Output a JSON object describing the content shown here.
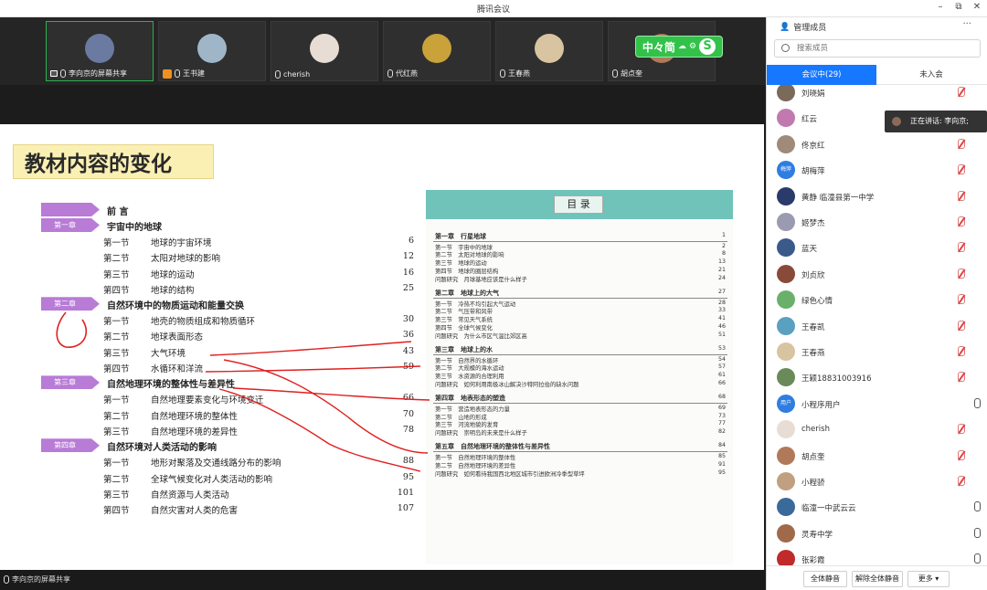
{
  "app": {
    "title": "腾讯会议"
  },
  "participants_strip": [
    {
      "name": "李向京的屏幕共享",
      "color": "#6a7aa0",
      "active": true
    },
    {
      "name": "王书建",
      "color": "#9fb6c8"
    },
    {
      "name": "cherish",
      "color": "#e8ddd4"
    },
    {
      "name": "代红燕",
      "color": "#c9a23a"
    },
    {
      "name": "王春燕",
      "color": "#d8c4a0"
    },
    {
      "name": "胡点奎",
      "color": "#b07a5a"
    }
  ],
  "ime": {
    "label": "中々简",
    "logo": "S"
  },
  "slide": {
    "title": "教材内容的变化",
    "toc": [
      {
        "tag": "",
        "title": "前 言",
        "sections": []
      },
      {
        "tag": "第一章",
        "title": "宇宙中的地球",
        "sections": [
          {
            "n": "第一节",
            "t": "地球的宇宙环境",
            "p": "6"
          },
          {
            "n": "第二节",
            "t": "太阳对地球的影响",
            "p": "12"
          },
          {
            "n": "第三节",
            "t": "地球的运动",
            "p": "16"
          },
          {
            "n": "第四节",
            "t": "地球的结构",
            "p": "25"
          }
        ]
      },
      {
        "tag": "第二章",
        "title": "自然环境中的物质运动和能量交换",
        "sections": [
          {
            "n": "第一节",
            "t": "地壳的物质组成和物质循环",
            "p": "30"
          },
          {
            "n": "第二节",
            "t": "地球表面形态",
            "p": "36"
          },
          {
            "n": "第三节",
            "t": "大气环境",
            "p": "43"
          },
          {
            "n": "第四节",
            "t": "水循环和洋流",
            "p": "59"
          }
        ]
      },
      {
        "tag": "第三章",
        "title": "自然地理环境的整体性与差异性",
        "sections": [
          {
            "n": "第一节",
            "t": "自然地理要素变化与环境变迁",
            "p": "66"
          },
          {
            "n": "第二节",
            "t": "自然地理环境的整体性",
            "p": "70"
          },
          {
            "n": "第三节",
            "t": "自然地理环境的差异性",
            "p": "78"
          }
        ]
      },
      {
        "tag": "第四章",
        "title": "自然环境对人类活动的影响",
        "sections": [
          {
            "n": "第一节",
            "t": "地形对聚落及交通线路分布的影响",
            "p": "88"
          },
          {
            "n": "第二节",
            "t": "全球气候变化对人类活动的影响",
            "p": "95"
          },
          {
            "n": "第三节",
            "t": "自然资源与人类活动",
            "p": "101"
          },
          {
            "n": "第四节",
            "t": "自然灾害对人类的危害",
            "p": "107"
          }
        ]
      }
    ],
    "book": {
      "heading": "目 录",
      "entries": [
        {
          "t": "第一章　行星地球",
          "p": "1",
          "ch": true
        },
        {
          "t": "第一节　宇宙中的地球",
          "p": "2"
        },
        {
          "t": "第二节　太阳对地球的影响",
          "p": "8"
        },
        {
          "t": "第三节　地球的运动",
          "p": "13"
        },
        {
          "t": "第四节　地球的圈层结构",
          "p": "21"
        },
        {
          "t": "问题研究　月球基地应该是什么样子",
          "p": "24"
        },
        {
          "t": "第二章　地球上的大气",
          "p": "27",
          "ch": true
        },
        {
          "t": "第一节　冷热不均引起大气运动",
          "p": "28"
        },
        {
          "t": "第二节　气压带和风带",
          "p": "33"
        },
        {
          "t": "第三节　常见天气系统",
          "p": "41"
        },
        {
          "t": "第四节　全球气候变化",
          "p": "46"
        },
        {
          "t": "问题研究　为什么市区气温比郊区高",
          "p": "51"
        },
        {
          "t": "第三章　地球上的水",
          "p": "53",
          "ch": true
        },
        {
          "t": "第一节　自然界的水循环",
          "p": "54"
        },
        {
          "t": "第二节　大规模的海水运动",
          "p": "57"
        },
        {
          "t": "第三节　水资源的合理利用",
          "p": "61"
        },
        {
          "t": "问题研究　如何利用南极冰山解决沙特阿拉伯的缺水问题",
          "p": "66"
        },
        {
          "t": "第四章　地表形态的塑造",
          "p": "68",
          "ch": true
        },
        {
          "t": "第一节　营造地表形态的力量",
          "p": "69"
        },
        {
          "t": "第二节　山地的形成",
          "p": "73"
        },
        {
          "t": "第三节　河流地貌的发育",
          "p": "77"
        },
        {
          "t": "问题研究　崇明岛的未来是什么样子",
          "p": "82"
        },
        {
          "t": "第五章　自然地理环境的整体性与差异性",
          "p": "84",
          "ch": true
        },
        {
          "t": "第一节　自然地理环境的整体性",
          "p": "85"
        },
        {
          "t": "第二节　自然地理环境的差异性",
          "p": "91"
        },
        {
          "t": "问题研究　如何看待我国西北地区城市引进欧洲冷季型草坪",
          "p": "95"
        }
      ]
    }
  },
  "bottom": {
    "share_label": "李向京的屏幕共享"
  },
  "panel": {
    "header": "管理成员",
    "search_placeholder": "搜索成员",
    "tab_in": "会议中(29)",
    "tab_out": "未入会",
    "speaking": "正在讲话: 李向京;",
    "members": [
      {
        "name": "刘晓娟",
        "color": "#7a6a5a",
        "muted": true
      },
      {
        "name": "红云",
        "color": "#c07ab0",
        "muted": true
      },
      {
        "name": "佟京红",
        "color": "#a08a7a",
        "muted": true
      },
      {
        "name": "胡梅萍",
        "color": "#2f7de1",
        "muted": true,
        "text": "梅萍"
      },
      {
        "name": "黄静  临潼县第一中学",
        "color": "#2a3a6a",
        "muted": true
      },
      {
        "name": "姬梦杰",
        "color": "#9a9ab0",
        "muted": true
      },
      {
        "name": "蓝天",
        "color": "#3a5a8a",
        "muted": true
      },
      {
        "name": "刘贞欣",
        "color": "#8a4a3a",
        "muted": true
      },
      {
        "name": "绿色心情",
        "color": "#6ab06a",
        "muted": true
      },
      {
        "name": "王春凯",
        "color": "#5aa0c0",
        "muted": true
      },
      {
        "name": "王春燕",
        "color": "#d8c4a0",
        "muted": true
      },
      {
        "name": "王颖18831003916",
        "color": "#6a8a5a",
        "muted": true
      },
      {
        "name": "小程序用户",
        "color": "#2f7de1",
        "muted": false,
        "text": "用户"
      },
      {
        "name": "cherish",
        "color": "#e8ddd4",
        "muted": true
      },
      {
        "name": "胡点奎",
        "color": "#b07a5a",
        "muted": true
      },
      {
        "name": "小程骄",
        "color": "#c0a080",
        "muted": true
      },
      {
        "name": "临潼一中武云云",
        "color": "#3a6a9a",
        "muted": false
      },
      {
        "name": "灵寿中学",
        "color": "#a06a4a",
        "muted": false
      },
      {
        "name": "张彩霞",
        "color": "#c02a2a",
        "muted": false
      }
    ],
    "footer": {
      "mute_all": "全体静音",
      "unmute_all": "解除全体静音",
      "more": "更多 ▾"
    }
  }
}
